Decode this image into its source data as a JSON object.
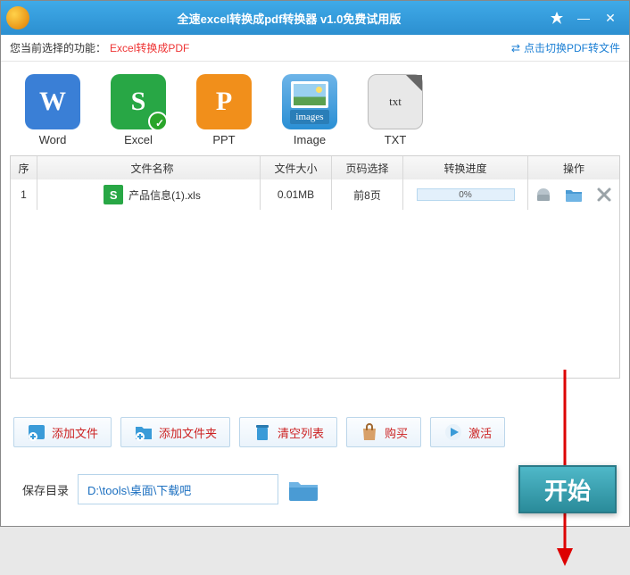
{
  "titlebar": {
    "title": "全速excel转换成pdf转换器 v1.0免费试用版"
  },
  "subbar": {
    "func_label": "您当前选择的功能：",
    "func_value": "Excel转换成PDF",
    "switch_label": "点击切换PDF转文件"
  },
  "formats": {
    "word": "Word",
    "excel": "Excel",
    "ppt": "PPT",
    "image": "Image",
    "txt": "TXT",
    "images_badge": "images",
    "txt_inner": "txt"
  },
  "table": {
    "headers": {
      "seq": "序",
      "name": "文件名称",
      "size": "文件大小",
      "pages": "页码选择",
      "progress": "转换进度",
      "ops": "操作"
    },
    "rows": [
      {
        "seq": "1",
        "name": "产品信息(1).xls",
        "size": "0.01MB",
        "pages": "前8页",
        "progress": "0%"
      }
    ]
  },
  "toolbar": {
    "add_file": "添加文件",
    "add_folder": "添加文件夹",
    "clear": "清空列表",
    "buy": "购买",
    "activate": "激活"
  },
  "bottom": {
    "save_label": "保存目录",
    "path": "D:\\tools\\桌面\\下载吧",
    "start": "开始"
  }
}
